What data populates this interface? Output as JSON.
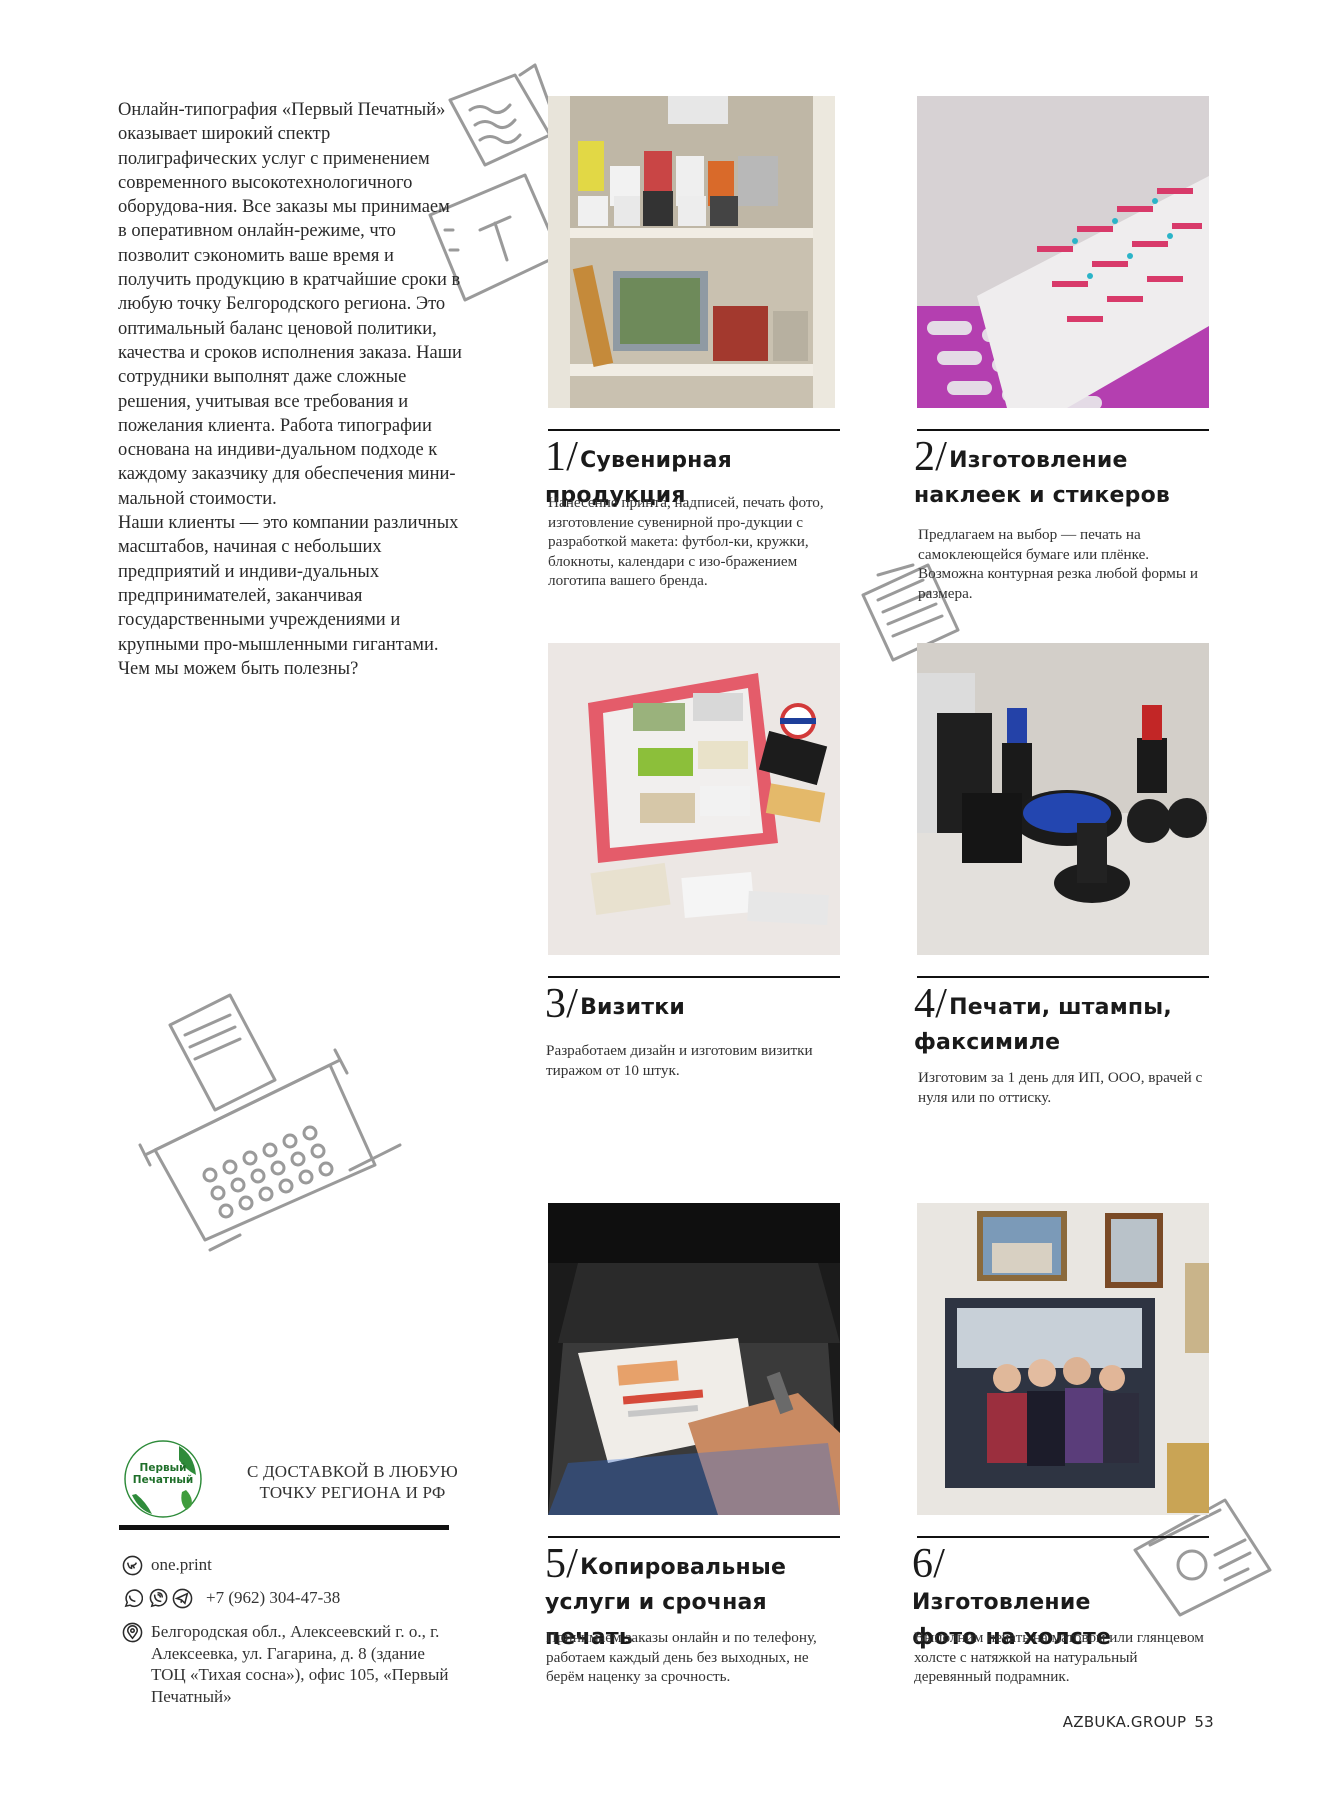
{
  "intro": {
    "paragraphs": [
      "Онлайн-типография «Первый Печатный» оказывает широкий спектр полиграфических услуг с применением современного высокотехнологичного оборудова-ния. Все заказы мы принимаем в оперативном онлайн-режиме, что позволит сэкономить ваше время и получить продукцию в кратчайшие сроки в любую точку Белгородского региона. Это оптимальный баланс ценовой политики, качества и сроков исполнения заказа. Наши сотрудники выполнят даже сложные решения, учитывая все требования и пожелания клиента. Работа типографии основана на индиви-дуальном подходе к каждому заказчику для обеспечения мини-мальной стоимости.",
      "Наши клиенты — это компании различных масштабов, начиная с небольших предприятий и индиви-дуальных предпринимателей, заканчивая государственными учреждениями и крупными про-мышленными гигантами.",
      "Чем мы можем быть полезны?"
    ]
  },
  "services": [
    {
      "num": "1",
      "slash": "/",
      "title": "Сувенирная продукция",
      "desc": "Нанесение принта, надписей, печать фото, изготовление сувенирной про-дукции с разработкой макета: футбол-ки, кружки, блокноты, календари с изо-бражением логотипа вашего бренда."
    },
    {
      "num": "2",
      "slash": "/",
      "title": "Изготовление наклеек и стикеров",
      "desc": "Предлагаем на выбор — печать на самоклеющейся бумаге или плёнке. Возможна контурная резка любой формы и размера."
    },
    {
      "num": "3",
      "slash": "/",
      "title": "Визитки",
      "desc": "Разработаем дизайн и изготовим визитки тиражом от 10 штук."
    },
    {
      "num": "4",
      "slash": "/",
      "title": "Печати, штампы, факсимиле",
      "desc": "Изготовим за 1 день для ИП, ООО, врачей с нуля или по оттиску."
    },
    {
      "num": "5",
      "slash": "/",
      "title": "Копировальные услуги и срочная печать",
      "desc": "Принимаем заказы онлайн и по телефону, работаем каждый день без выходных, не берём наценку за срочность."
    },
    {
      "num": "6",
      "slash": "/",
      "title": "Изготовление фото на холсте",
      "desc": "Выполним печать на матовом или глянцевом холсте с натяжкой на натуральный деревянный подрамник."
    }
  ],
  "contact": {
    "logo_text": "Первый Печатный",
    "delivery": "С ДОСТАВКОЙ В ЛЮБУЮ ТОЧКУ РЕГИОНА И РФ",
    "vk": "one.print",
    "phone": "+7 (962) 304-47-38",
    "address": "Белгородская обл., Алексеевский г. о., г. Алексеевка, ул. Гагарина, д. 8 (здание ТОЦ «Тихая сосна»), офис 105, «Первый Печатный»"
  },
  "footer": {
    "site": "AZBUKA.GROUP",
    "page": "53"
  },
  "icons": {
    "vk": "vk-icon",
    "whatsapp": "whatsapp-icon",
    "viber": "viber-icon",
    "telegram": "telegram-icon",
    "location": "location-pin-icon"
  }
}
